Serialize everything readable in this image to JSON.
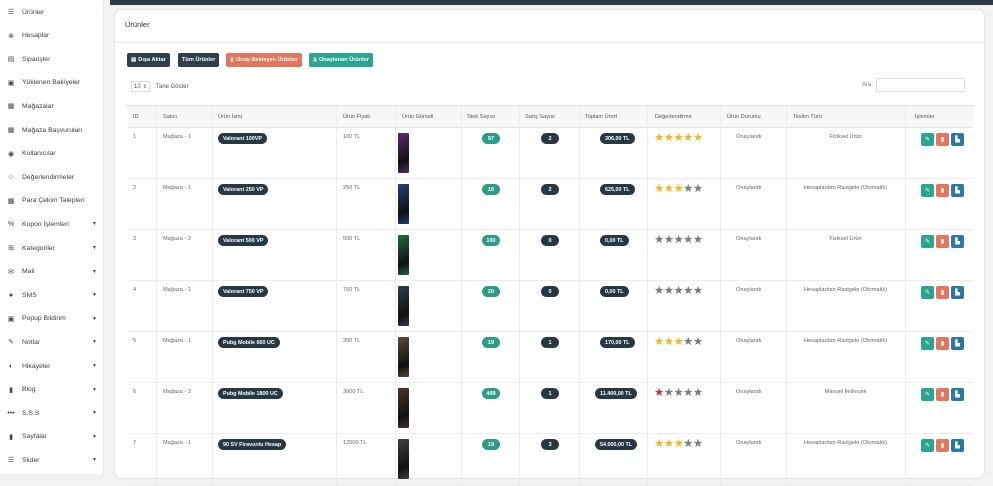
{
  "sidebar": {
    "items": [
      {
        "icon": "list-icon",
        "glyph": "☰",
        "label": "Ürünler",
        "caret": false
      },
      {
        "icon": "account-icon",
        "glyph": "⊗",
        "label": "Hesaplar",
        "caret": false
      },
      {
        "icon": "orders-icon",
        "glyph": "▤",
        "label": "Siparişler",
        "caret": false
      },
      {
        "icon": "balance-icon",
        "glyph": "▣",
        "label": "Yüklenen Bakiyeler",
        "caret": false
      },
      {
        "icon": "store-icon",
        "glyph": "▦",
        "label": "Mağazalar",
        "caret": false
      },
      {
        "icon": "store-apply-icon",
        "glyph": "▦",
        "label": "Mağaza Başvuruları",
        "caret": false
      },
      {
        "icon": "user-icon",
        "glyph": "◉",
        "label": "Kullanıcılar",
        "caret": false
      },
      {
        "icon": "star-icon",
        "glyph": "☆",
        "label": "Değerlendirmeler",
        "caret": false
      },
      {
        "icon": "money-icon",
        "glyph": "▩",
        "label": "Para Çekim Talepleri",
        "caret": false
      },
      {
        "icon": "percent-icon",
        "glyph": "%",
        "label": "Kupon İşlemleri",
        "caret": true
      },
      {
        "icon": "category-icon",
        "glyph": "⊞",
        "label": "Kategoriler",
        "caret": true
      },
      {
        "icon": "mail-icon",
        "glyph": "✉",
        "label": "Mail",
        "caret": true
      },
      {
        "icon": "sms-icon",
        "glyph": "●",
        "label": "SMS",
        "caret": true
      },
      {
        "icon": "popup-icon",
        "glyph": "▣",
        "label": "Popup Bildirim",
        "caret": true
      },
      {
        "icon": "notes-icon",
        "glyph": "✎",
        "label": "Notlar",
        "caret": true
      },
      {
        "icon": "story-icon",
        "glyph": "◐",
        "label": "Hikayeler",
        "caret": true
      },
      {
        "icon": "blog-icon",
        "glyph": "▮",
        "label": "Blog",
        "caret": true
      },
      {
        "icon": "faq-icon",
        "glyph": "•••",
        "label": "S.S.S",
        "caret": true
      },
      {
        "icon": "pages-icon",
        "glyph": "▮",
        "label": "Sayfalar",
        "caret": true
      },
      {
        "icon": "slider-icon",
        "glyph": "☰",
        "label": "Slider",
        "caret": true
      }
    ],
    "caret_glyph": "▼"
  },
  "main": {
    "title": "Ürünler",
    "buttons": {
      "export": "Dışa Aktar",
      "all": "Tüm Ürünler",
      "pending": "Onay Bekleyen Ürünler",
      "approved": "Onaylanan Ürünler"
    },
    "length_value": "10",
    "length_label": "Tane Göster",
    "search_label": "Ara:",
    "columns": [
      "ID",
      "Satıcı",
      "Ürün İsmi",
      "Ürün Fiyatı",
      "Ürün Görseli",
      "Stok Sayısı",
      "Satış Sayısı",
      "Toplam Ürnrt",
      "Değerlendirme",
      "Ürün Durumu",
      "Teslim Türü",
      "İşlemler"
    ],
    "rows": [
      {
        "id": "1",
        "seller": "Mağaza - 1",
        "name": "Valorant 100VP",
        "price": "100 TL",
        "stock": "97",
        "sales": "2",
        "total": "306,00 TL",
        "stars": 5,
        "star_style": "gold",
        "status": "Onaylandı",
        "delivery": "Fiziksel Ürün",
        "thumb": "#5a2a6e"
      },
      {
        "id": "2",
        "seller": "Mağaza - 1",
        "name": "Valorant 250 VP",
        "price": "250 TL",
        "stock": "15",
        "sales": "2",
        "total": "625,00 TL",
        "stars": 3,
        "star_style": "gold",
        "status": "Onaylandı",
        "delivery": "Hesaplardan Rastgele (Otomatik)",
        "thumb": "#1f3f7a"
      },
      {
        "id": "3",
        "seller": "Mağaza - 2",
        "name": "Valorant 500 VP",
        "price": "500 TL",
        "stock": "100",
        "sales": "0",
        "total": "0,00 TL",
        "stars": 0,
        "star_style": "gold",
        "status": "Onaylandı",
        "delivery": "Fiziksel Ürün",
        "thumb": "#1e6a3e"
      },
      {
        "id": "4",
        "seller": "Mağaza - 1",
        "name": "Valorant 750 VP",
        "price": "750 TL",
        "stock": "20",
        "sales": "0",
        "total": "0,00 TL",
        "stars": 0,
        "star_style": "gold",
        "status": "Onaylandı",
        "delivery": "Hesaplardan Rastgele (Otomatik)",
        "thumb": "#2d3c52"
      },
      {
        "id": "5",
        "seller": "Mağaza - 1",
        "name": "Pubg Mobile 660 UC",
        "price": "200 TL",
        "stock": "19",
        "sales": "1",
        "total": "170,00 TL",
        "stars": 3,
        "star_style": "gold",
        "status": "Onaylandı",
        "delivery": "Hesaplardan Rastgele (Otomatik)",
        "thumb": "#5a4a35"
      },
      {
        "id": "6",
        "seller": "Mağaza - 2",
        "name": "Pubg Mobile 1800 UC",
        "price": "3000 TL",
        "stock": "499",
        "sales": "1",
        "total": "11.400,00 TL",
        "stars": 1,
        "star_style": "red",
        "status": "Onaylandı",
        "delivery": "Manuel İletilecek",
        "thumb": "#4a3328"
      },
      {
        "id": "7",
        "seller": "Mağaza - 1",
        "name": "90 SV Firavunlu Hesap",
        "price": "12000 TL",
        "stock": "19",
        "sales": "3",
        "total": "54.000,00 TL",
        "stars": 3,
        "star_style": "gold",
        "status": "Onaylandı",
        "delivery": "Hesaplardan Rastgele (Otomatik)",
        "thumb": "#3a3f48"
      }
    ]
  },
  "colors": {
    "accent_teal": "#2aa58f",
    "accent_red": "#e2775d",
    "dark": "#263845",
    "info_blue": "#2a78a8",
    "star_gold": "#f1b820"
  },
  "icons": {
    "edit": "✎",
    "delete": "▮",
    "stats": "▙"
  }
}
